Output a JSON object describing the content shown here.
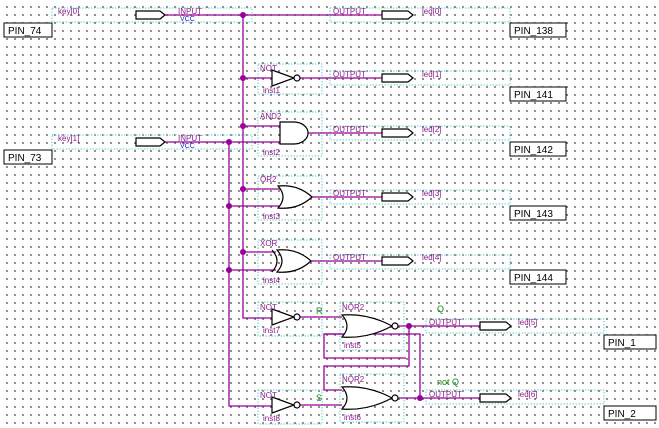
{
  "inputs": [
    {
      "name": "key[0]",
      "type_label": "INPUT",
      "vcc_label": "VCC",
      "pin": "PIN_74"
    },
    {
      "name": "key[1]",
      "type_label": "INPUT",
      "vcc_label": "VCC",
      "pin": "PIN_73"
    }
  ],
  "outputs": [
    {
      "name": "led[0]",
      "type_label": "OUTPUT",
      "pin": "PIN_138"
    },
    {
      "name": "led[1]",
      "type_label": "OUTPUT",
      "pin": "PIN_141"
    },
    {
      "name": "led[2]",
      "type_label": "OUTPUT",
      "pin": "PIN_142"
    },
    {
      "name": "led[3]",
      "type_label": "OUTPUT",
      "pin": "PIN_143"
    },
    {
      "name": "led[4]",
      "type_label": "OUTPUT",
      "pin": "PIN_144"
    },
    {
      "name": "led[5]",
      "type_label": "OUTPUT",
      "pin": "PIN_1"
    },
    {
      "name": "led[6]",
      "type_label": "OUTPUT",
      "pin": "PIN_2"
    }
  ],
  "gates": [
    {
      "type": "NOT",
      "inst": "inst1"
    },
    {
      "type": "AND2",
      "inst": "inst2"
    },
    {
      "type": "OR2",
      "inst": "inst3"
    },
    {
      "type": "XOR",
      "inst": "inst4"
    },
    {
      "type": "NOT",
      "inst": "inst7"
    },
    {
      "type": "NOR2",
      "inst": "inst5"
    },
    {
      "type": "NOT",
      "inst": "inst8"
    },
    {
      "type": "NOR2",
      "inst": "inst6"
    }
  ],
  "net_labels": {
    "r": "R",
    "s": "S",
    "q": "Q",
    "not_q": "not Q"
  },
  "colors": {
    "wire": "#990099",
    "label": "#8b1a8b",
    "vcc": "#2020d0",
    "net": "#118811",
    "grid": "#6f6f6f"
  }
}
